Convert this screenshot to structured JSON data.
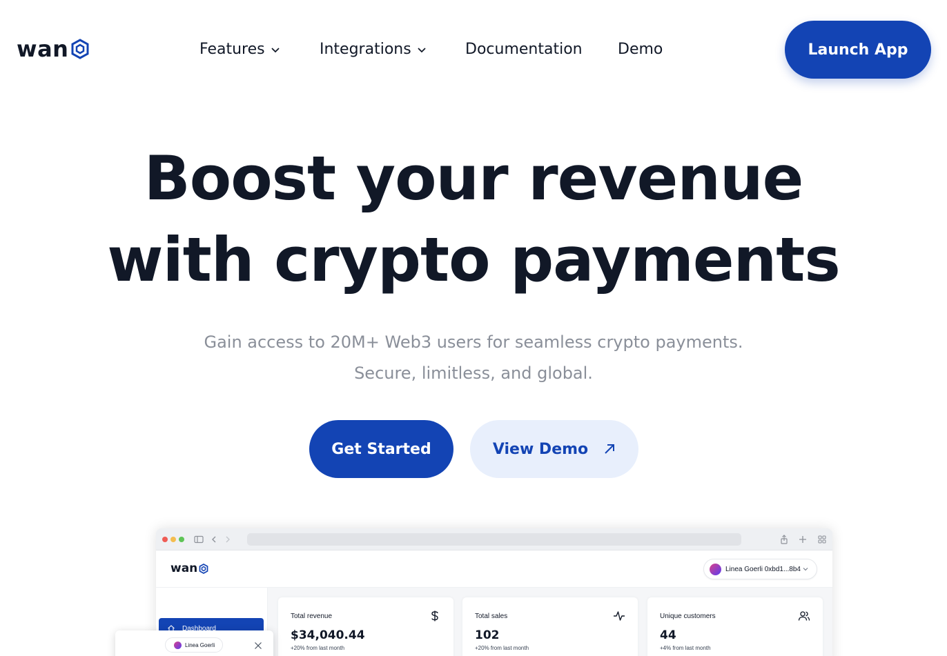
{
  "nav": {
    "logo_text": "wan",
    "links": [
      {
        "label": "Features",
        "has_dropdown": true
      },
      {
        "label": "Integrations",
        "has_dropdown": true
      },
      {
        "label": "Documentation",
        "has_dropdown": false
      },
      {
        "label": "Demo",
        "has_dropdown": false
      }
    ],
    "launch_label": "Launch App"
  },
  "hero": {
    "title_line1": "Boost your revenue",
    "title_line2": "with crypto payments",
    "subtitle_line1": "Gain access to 20M+ Web3 users for seamless crypto payments.",
    "subtitle_line2": "Secure, limitless, and global.",
    "primary_cta": "Get Started",
    "secondary_cta": "View Demo"
  },
  "preview": {
    "logo_text": "wan",
    "wallet_label": "Linea Goerli 0xbd1...8b4",
    "sidebar_item": "Dashboard",
    "stats": [
      {
        "label": "Total revenue",
        "value": "$34,040.44",
        "note": "+20% from last month",
        "icon": "dollar-icon"
      },
      {
        "label": "Total sales",
        "value": "102",
        "note": "+20% from last month",
        "icon": "activity-icon"
      },
      {
        "label": "Unique customers",
        "value": "44",
        "note": "+4% from last month",
        "icon": "users-icon"
      }
    ],
    "popup_chip": "Linea Goerli"
  },
  "colors": {
    "brand": "#1344b4",
    "secondary_bg": "#e8effc",
    "text": "#111827",
    "muted": "#8a8f99"
  }
}
